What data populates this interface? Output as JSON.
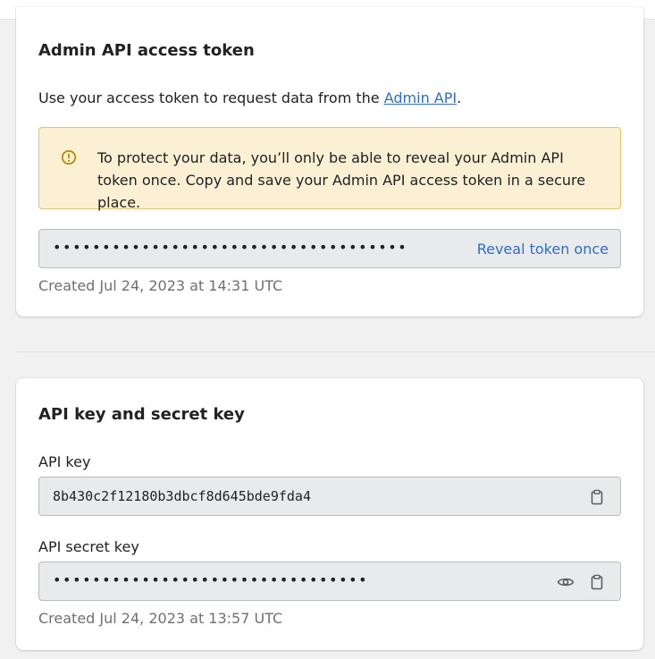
{
  "admin_token_card": {
    "title": "Admin API access token",
    "description_prefix": "Use your access token to request data from the ",
    "description_link": "Admin API",
    "description_suffix": ".",
    "banner": {
      "icon": "exclamation-circle-icon",
      "message": "To protect your data, you’ll only be able to reveal your Admin API token once. Copy and save your Admin API access token in a secure place."
    },
    "token_field": {
      "masked_value": "••••••••••••••••••••••••••••••••••••",
      "reveal_label": "Reveal token once"
    },
    "created": "Created Jul 24, 2023 at 14:31 UTC"
  },
  "api_keys_card": {
    "title": "API key and secret key",
    "api_key": {
      "label": "API key",
      "value": "8b430c2f12180b3dbcf8d645bde9fda4",
      "copy_icon": "clipboard-icon"
    },
    "api_secret_key": {
      "label": "API secret key",
      "masked_value": "••••••••••••••••••••••••••••••••",
      "show_icon": "eye-icon",
      "copy_icon": "clipboard-icon"
    },
    "created": "Created Jul 24, 2023 at 13:57 UTC"
  },
  "colors": {
    "link": "#2c6ecb",
    "banner_bg": "#fcf0d4",
    "banner_border": "#e8c26a",
    "warning_icon": "#b98900",
    "field_bg": "#e9eaec",
    "muted_text": "#6d7175"
  }
}
